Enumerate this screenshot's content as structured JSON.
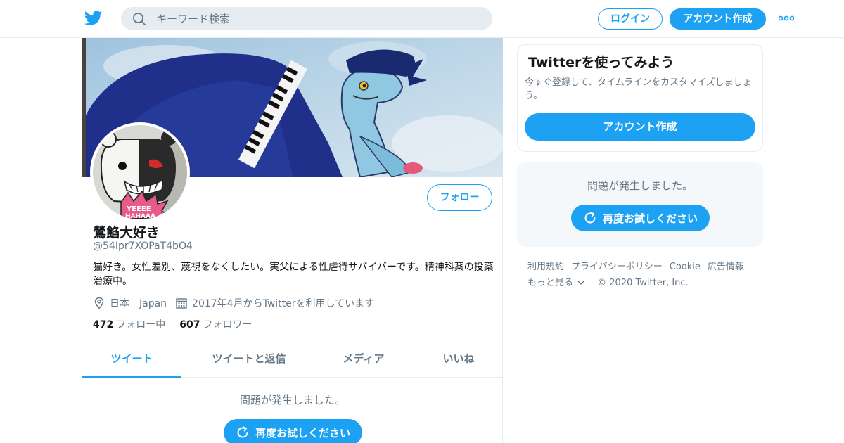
{
  "colors": {
    "accent": "#1da1f2",
    "muted": "#657786",
    "text": "#14171a",
    "border": "#e6ecf0"
  },
  "header": {
    "search_placeholder": "キーワード検索",
    "login_label": "ログイン",
    "signup_label": "アカウント作成",
    "icons": [
      "twitter-bird-icon",
      "search-icon",
      "more-icon"
    ]
  },
  "profile": {
    "follow_label": "フォロー",
    "name": "鶯餡大好き",
    "handle": "@54Ipr7XOPaT4bO4",
    "bio": "猫好き。女性差別、蔑視をなくしたい。実父による性虐待サバイバーです。精神科薬の投薬治療中。",
    "location": "日本　Japan",
    "joined": "2017年4月からTwitterを利用しています",
    "following_count": "472",
    "following_label": "フォロー中",
    "followers_count": "607",
    "followers_label": "フォロワー"
  },
  "tabs": [
    {
      "label": "ツイート",
      "active": true
    },
    {
      "label": "ツイートと返信",
      "active": false
    },
    {
      "label": "メディア",
      "active": false
    },
    {
      "label": "いいね",
      "active": false
    }
  ],
  "timeline": {
    "error_text": "問題が発生しました。",
    "retry_label": "再度お試しください"
  },
  "sidebar": {
    "card_title": "Twitterを使ってみよう",
    "card_desc": "今すぐ登録して、タイムラインをカスタマイズしましょう。",
    "card_button": "アカウント作成",
    "error_text": "問題が発生しました。",
    "retry_label": "再度お試しください",
    "footer": {
      "links": [
        "利用規約",
        "プライバシーポリシー",
        "Cookie",
        "広告情報"
      ],
      "more_label": "もっと見る",
      "copyright": "© 2020 Twitter, Inc."
    }
  }
}
